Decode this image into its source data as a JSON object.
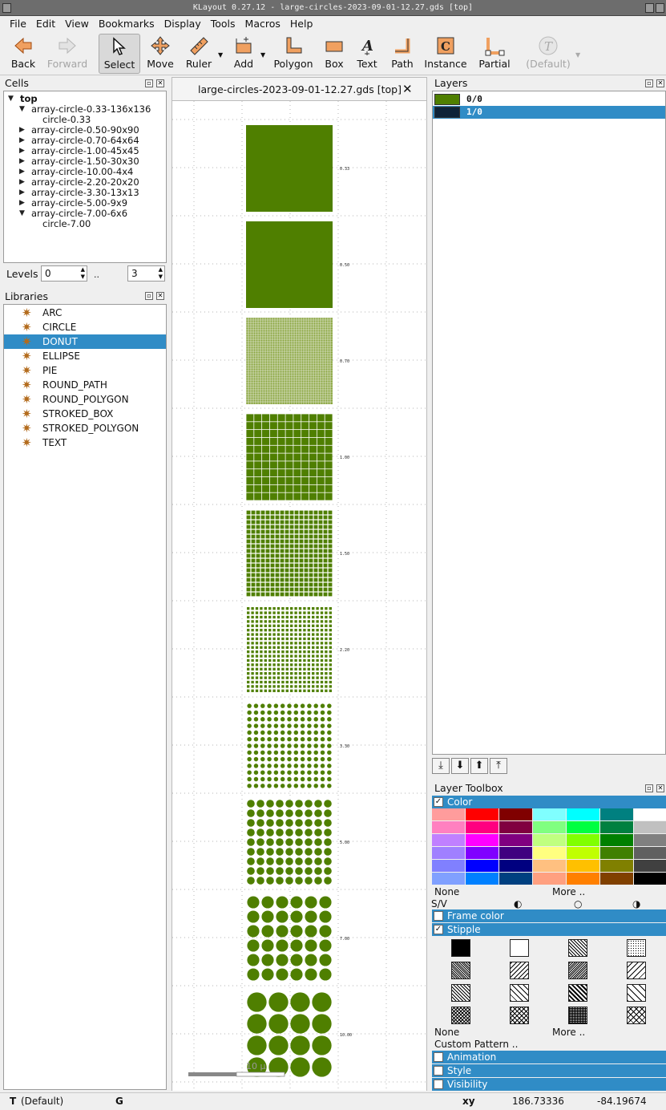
{
  "window": {
    "title": "KLayout 0.27.12 - large-circles-2023-09-01-12.27.gds [top]"
  },
  "menu": [
    "File",
    "Edit",
    "View",
    "Bookmarks",
    "Display",
    "Tools",
    "Macros",
    "Help"
  ],
  "toolbar": {
    "back": "Back",
    "forward": "Forward",
    "select": "Select",
    "move": "Move",
    "ruler": "Ruler",
    "add": "Add",
    "polygon": "Polygon",
    "box": "Box",
    "text": "Text",
    "path": "Path",
    "instance": "Instance",
    "partial": "Partial",
    "default": "(Default)"
  },
  "cells": {
    "title": "Cells",
    "rows": [
      "top",
      "array-circle-0.33-136x136",
      "circle-0.33",
      "array-circle-0.50-90x90",
      "array-circle-0.70-64x64",
      "array-circle-1.00-45x45",
      "array-circle-1.50-30x30",
      "array-circle-10.00-4x4",
      "array-circle-2.20-20x20",
      "array-circle-3.30-13x13",
      "array-circle-5.00-9x9",
      "array-circle-7.00-6x6",
      "circle-7.00"
    ]
  },
  "levels": {
    "label": "Levels",
    "from": "0",
    "sep": "..",
    "to": "3"
  },
  "libraries": {
    "title": "Libraries",
    "items": [
      "ARC",
      "CIRCLE",
      "DONUT",
      "ELLIPSE",
      "PIE",
      "ROUND_PATH",
      "ROUND_POLYGON",
      "STROKED_BOX",
      "STROKED_POLYGON",
      "TEXT"
    ]
  },
  "tab": {
    "label": "large-circles-2023-09-01-12.27.gds [top]",
    "close": "✕"
  },
  "canvas": {
    "labels": [
      "0.33",
      "0.50",
      "0.70",
      "1.00",
      "1.50",
      "2.20",
      "3.30",
      "5.00",
      "7.00",
      "10.00"
    ],
    "scale": "10 µ"
  },
  "layers": {
    "title": "Layers",
    "rows": [
      {
        "name": "0/0",
        "color": "#4f7f00"
      },
      {
        "name": "1/0",
        "color": "#0e2338"
      }
    ]
  },
  "toolbox": {
    "title": "Layer Toolbox",
    "color": "Color",
    "none": "None",
    "more": "More ..",
    "sv": "S/V",
    "frame_color": "Frame color",
    "stipple": "Stipple",
    "none2": "None",
    "more2": "More ..",
    "custom": "Custom Pattern ..",
    "animation": "Animation",
    "style": "Style",
    "visibility": "Visibility",
    "palette": [
      [
        "#ff9c9c",
        "#ff0000",
        "#800000",
        "#80ffff",
        "#00ffff",
        "#008080",
        "#ffffff"
      ],
      [
        "#ff80c0",
        "#ff0080",
        "#800040",
        "#80ff80",
        "#00ff40",
        "#008040",
        "#c0c0c0"
      ],
      [
        "#c080ff",
        "#ff00ff",
        "#800080",
        "#c0ff80",
        "#80ff00",
        "#008000",
        "#808080"
      ],
      [
        "#a080ff",
        "#8000ff",
        "#400080",
        "#ffff80",
        "#c0ff00",
        "#408000",
        "#606060"
      ],
      [
        "#8080ff",
        "#0000ff",
        "#000080",
        "#ffc080",
        "#ffc000",
        "#808000",
        "#404040"
      ],
      [
        "#80a0ff",
        "#0080ff",
        "#004080",
        "#ffa080",
        "#ff8000",
        "#804000",
        "#000000"
      ]
    ]
  },
  "status": {
    "mode": "T",
    "default": "(Default)",
    "g": "G",
    "xy": "xy",
    "x": "186.73336",
    "y": "-84.19674"
  }
}
